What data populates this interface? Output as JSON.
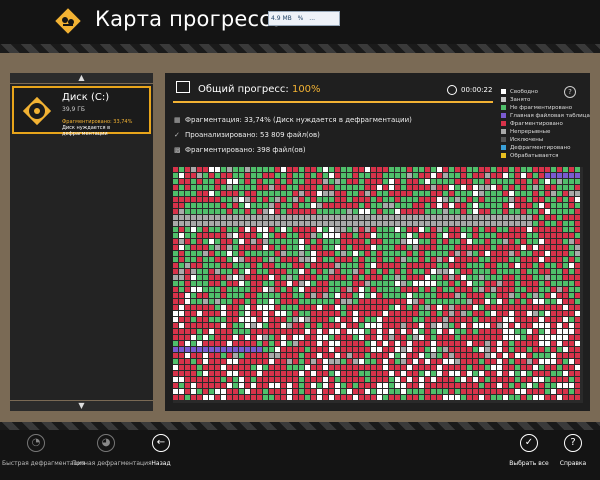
{
  "window": {
    "title": "Карта прогресса",
    "title_widget": [
      "4.9 MB",
      "%",
      "..."
    ]
  },
  "left_panel": {
    "drive": {
      "name": "Диск (C:)",
      "size": "39,9 ГБ",
      "fragmentation": "Фрагментировано: 33,74%",
      "status": "Диск нуждается в дефрагментации"
    },
    "scroll_up_icon": "chevron-up-icon",
    "scroll_down_icon": "chevron-down-icon"
  },
  "progress": {
    "label": "Общий прогресс:",
    "value": "100%",
    "time": "00:00:22"
  },
  "stats": {
    "fragmentation": "Фрагментация: 33,74% (Диск нуждается в дефрагментации)",
    "analyzed": "Проанализировано: 53 809 файл(ов)",
    "fragmented": "Фрагментировано: 398 файл(ов)"
  },
  "legend": [
    {
      "label": "Свободно",
      "color": "#ffffff"
    },
    {
      "label": "Занято",
      "color": "#c8c8c8"
    },
    {
      "label": "Не фрагментировано",
      "color": "#4fbf6a"
    },
    {
      "label": "Главная файловая таблица",
      "color": "#7a5ad0"
    },
    {
      "label": "Фрагментировано",
      "color": "#d8324a"
    },
    {
      "label": "Непрерывные",
      "color": "#a9a9a9"
    },
    {
      "label": "Исключены",
      "color": "#555555"
    },
    {
      "label": "Дефрагментировано",
      "color": "#3aa0d8"
    },
    {
      "label": "Обрабатывается",
      "color": "#e8c020"
    }
  ],
  "bottom_bar": {
    "quick_defrag": "Быстрая дефрагментация",
    "full_defrag": "Полная дефрагментация",
    "back": "Назад",
    "select_all": "Выбрать все",
    "help": "Справка"
  },
  "colors": {
    "accent": "#f2b233",
    "free": "#ffffff",
    "fragmented": "#d8324a",
    "not_fragmented": "#4fbf6a",
    "contiguous": "#a9a9a9",
    "mft": "#7a5ad0"
  }
}
